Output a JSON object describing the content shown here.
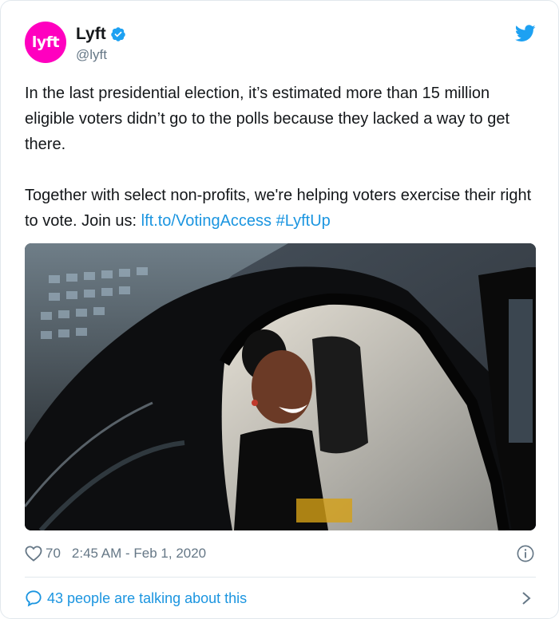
{
  "author": {
    "avatar_text": "lyft",
    "display_name": "Lyft",
    "handle": "@lyft",
    "verified": true,
    "avatar_color": "#ff00bf"
  },
  "tweet": {
    "paragraph1": "In the last presidential election, it’s estimated more than 15 million eligible voters didn’t go to the polls because they lacked a way to get there.",
    "paragraph2_text": "Together with select non-profits, we're helping voters exercise their right to vote. Join us: ",
    "link_url_text": "lft.to/VotingAccess",
    "hashtag": "#LyftUp"
  },
  "media": {
    "icon": "photo"
  },
  "meta": {
    "likes": "70",
    "timestamp": "2:45 AM - Feb 1, 2020"
  },
  "footer": {
    "talking_text": "43 people are talking about this"
  },
  "colors": {
    "link": "#1b95e0",
    "text": "#14171a",
    "secondary": "#657786",
    "border": "#e1e8ed",
    "twitter_blue": "#1da1f2"
  }
}
